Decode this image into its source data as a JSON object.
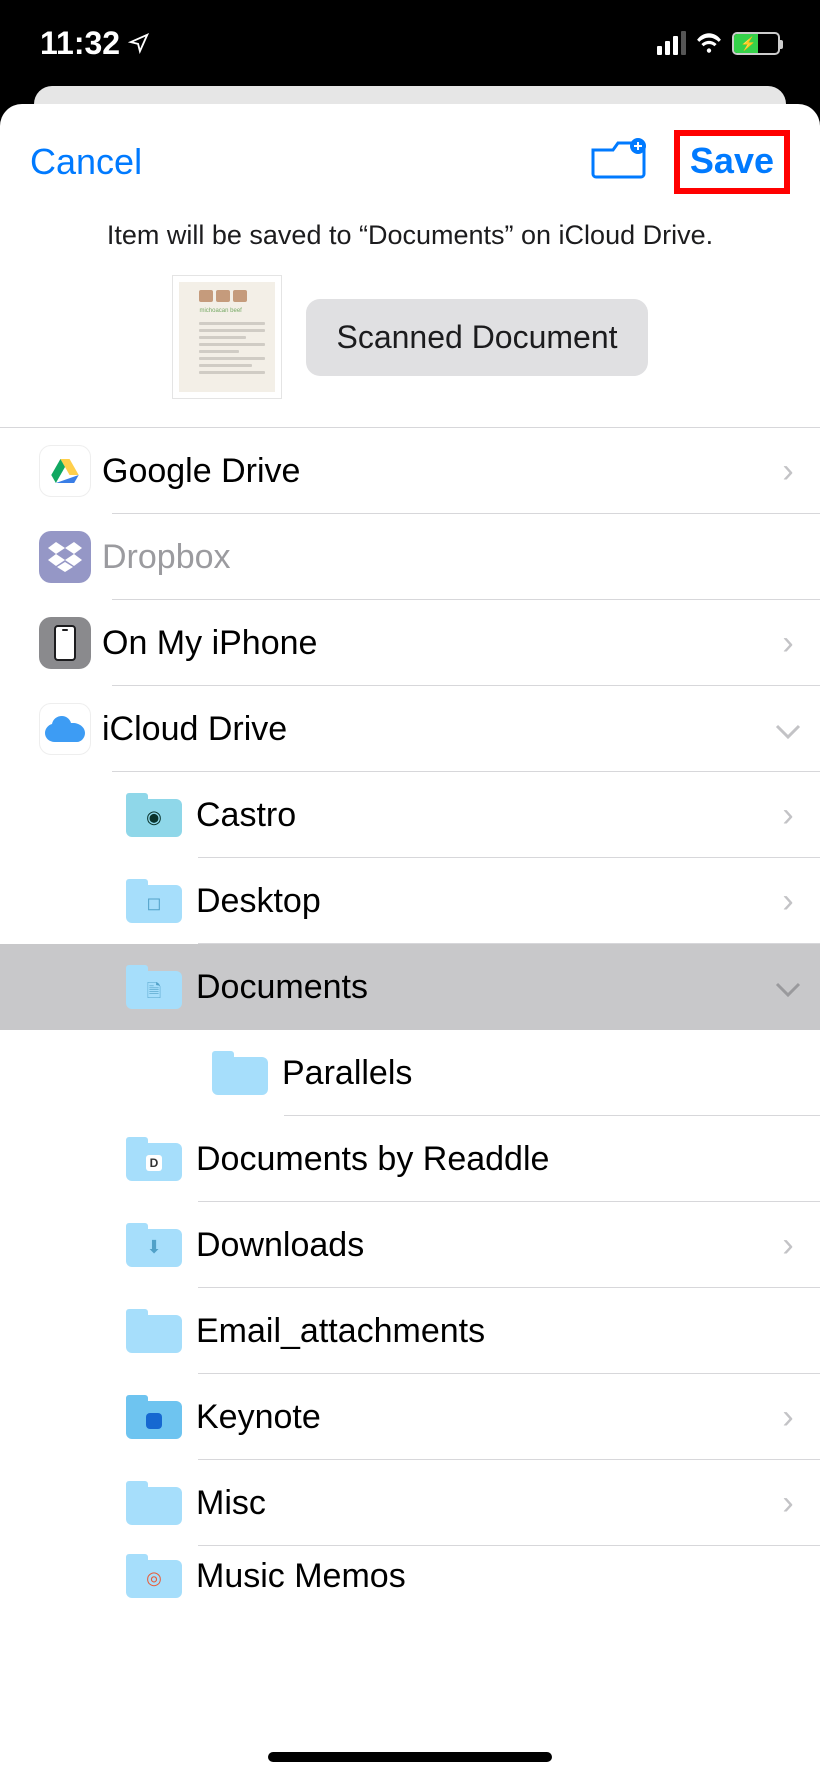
{
  "status": {
    "time": "11:32",
    "location_icon": "location-arrow-icon"
  },
  "nav": {
    "cancel": "Cancel",
    "save": "Save"
  },
  "destination_text": "Item will be saved to “Documents” on iCloud Drive.",
  "document": {
    "name": "Scanned Document",
    "thumb_caption": "michoacan beef"
  },
  "locations": {
    "google_drive": "Google Drive",
    "dropbox": "Dropbox",
    "on_my_iphone": "On My iPhone",
    "icloud_drive": "iCloud Drive",
    "icloud_children": {
      "castro": "Castro",
      "desktop": "Desktop",
      "documents": "Documents",
      "documents_children": {
        "parallels": "Parallels"
      },
      "documents_by_readdle": "Documents by Readdle",
      "downloads": "Downloads",
      "email_attachments": "Email_attachments",
      "keynote": "Keynote",
      "misc": "Misc",
      "music_memos": "Music Memos"
    }
  }
}
